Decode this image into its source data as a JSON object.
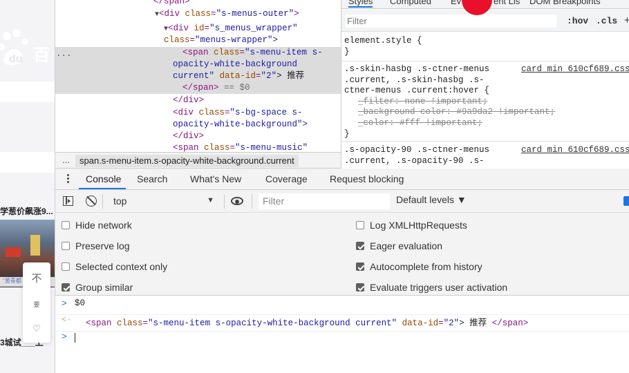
{
  "page_strip": {
    "logo_text": "百",
    "news_headline_1": "学葱价飙涨9...",
    "image_caption": "\"葱青都",
    "news_headline_2": "3城试___上"
  },
  "side_tools": {
    "icon_1": "不",
    "icon_2": "要",
    "icon_3": "♡"
  },
  "elements_panel": {
    "lines": [
      {
        "type": "close",
        "text": "</span>"
      },
      {
        "type": "open",
        "tag": "div",
        "attr": "class",
        "value": "s-menus-outer"
      },
      {
        "type": "open",
        "tag": "div",
        "attr": "id",
        "value": "s_menus_wrapper",
        "attr2": "class",
        "value2": "menus-wrapper"
      },
      {
        "type": "close",
        "text": "</div>"
      },
      {
        "type": "open",
        "tag": "div",
        "attr": "class",
        "value": "s-bg-space s-opacity-white-background"
      },
      {
        "type": "close",
        "text": "</div>"
      },
      {
        "type": "open",
        "tag": "span",
        "attr": "class",
        "value": "s-menu-music"
      }
    ],
    "selected": {
      "tag": "span",
      "class_value": "s-menu-item s-opacity-white-background current",
      "data_id": "2",
      "text": "推荐",
      "close": "</span>",
      "suffix": "== $0"
    },
    "labels": {
      "span_close": "</span>",
      "div_open": "<div ",
      "class_attr": "class",
      "id_attr": "id",
      "class_val_outer": "\"s-menus-outer\"",
      "id_val": "\"s_menus_wrapper\"",
      "class_val_wrapper": "\"menus-wrapper\">",
      "span_open": "<span ",
      "sel_class_1": "\"s-menu-item s-",
      "sel_class_2": "opacity-white-background",
      "sel_class_3": "current\"",
      "data_id_attr": "data-id",
      "data_id_val": "\"2\"",
      "sel_text": "> 推荐",
      "sel_close": "</span>",
      "sel_eq": " == $0",
      "div_close": "</div>",
      "bgspace_1": "\"s-bg-space s-",
      "bgspace_2": "opacity-white-background\">",
      "music": "\"s-menu-music\""
    },
    "gutter": "..."
  },
  "breadcrumb": {
    "dots": "...",
    "path": "span.s-menu-item.s-opacity-white-background.current"
  },
  "styles_panel": {
    "tabs": [
      "Styles",
      "Computed",
      "Ev",
      "ent Lis",
      "DOM Breakpoints"
    ],
    "filter_placeholder": "Filter",
    "hov": ":hov",
    "cls": ".cls",
    "plus": "+",
    "element_style": "element.style {",
    "close_brace": "}",
    "rule1": {
      "selector_1": ".s-skin-hasbg .s-ctner-menus",
      "selector_2": ".current, .s-skin-hasbg .s-",
      "selector_3": "ctner-menus .current:hover {",
      "decl_1": "_filter: none !important;",
      "decl_2": "_background-color: #9a9da2 !important;",
      "decl_3": "_color: #fff !important;",
      "source": "card_min_610cf689.css"
    },
    "rule2": {
      "selector_1": ".s-opacity-90 .s-ctner-menus",
      "selector_2": ".current, .s-opacity-90 .s-",
      "source": "card_min_610cf689.css"
    }
  },
  "console": {
    "tabs": [
      "Console",
      "Search",
      "What's New",
      "Coverage",
      "Request blocking"
    ],
    "active_tab": "Console",
    "context": "top",
    "filter_placeholder": "Filter",
    "levels": "Default levels ▼",
    "settings_left": [
      {
        "label": "Hide network",
        "checked": false
      },
      {
        "label": "Preserve log",
        "checked": false
      },
      {
        "label": "Selected context only",
        "checked": false
      },
      {
        "label": "Group similar",
        "checked": true
      }
    ],
    "settings_right": [
      {
        "label": "Log XMLHttpRequests",
        "checked": false
      },
      {
        "label": "Eager evaluation",
        "checked": true
      },
      {
        "label": "Autocomplete from history",
        "checked": true
      },
      {
        "label": "Evaluate triggers user activation",
        "checked": true
      }
    ],
    "log": {
      "input_prompt": ">",
      "input_expr": "$0",
      "return_arrow": "<·",
      "result_tag_open": "<span ",
      "result_class_attr": "class",
      "result_class_val": "\"s-menu-item s-opacity-white-background current\"",
      "result_dataid_attr": "data-id",
      "result_dataid_val": "\"2\"",
      "result_text": "> 推荐  ",
      "result_close": "</span>",
      "cursor_prompt": ">"
    }
  }
}
